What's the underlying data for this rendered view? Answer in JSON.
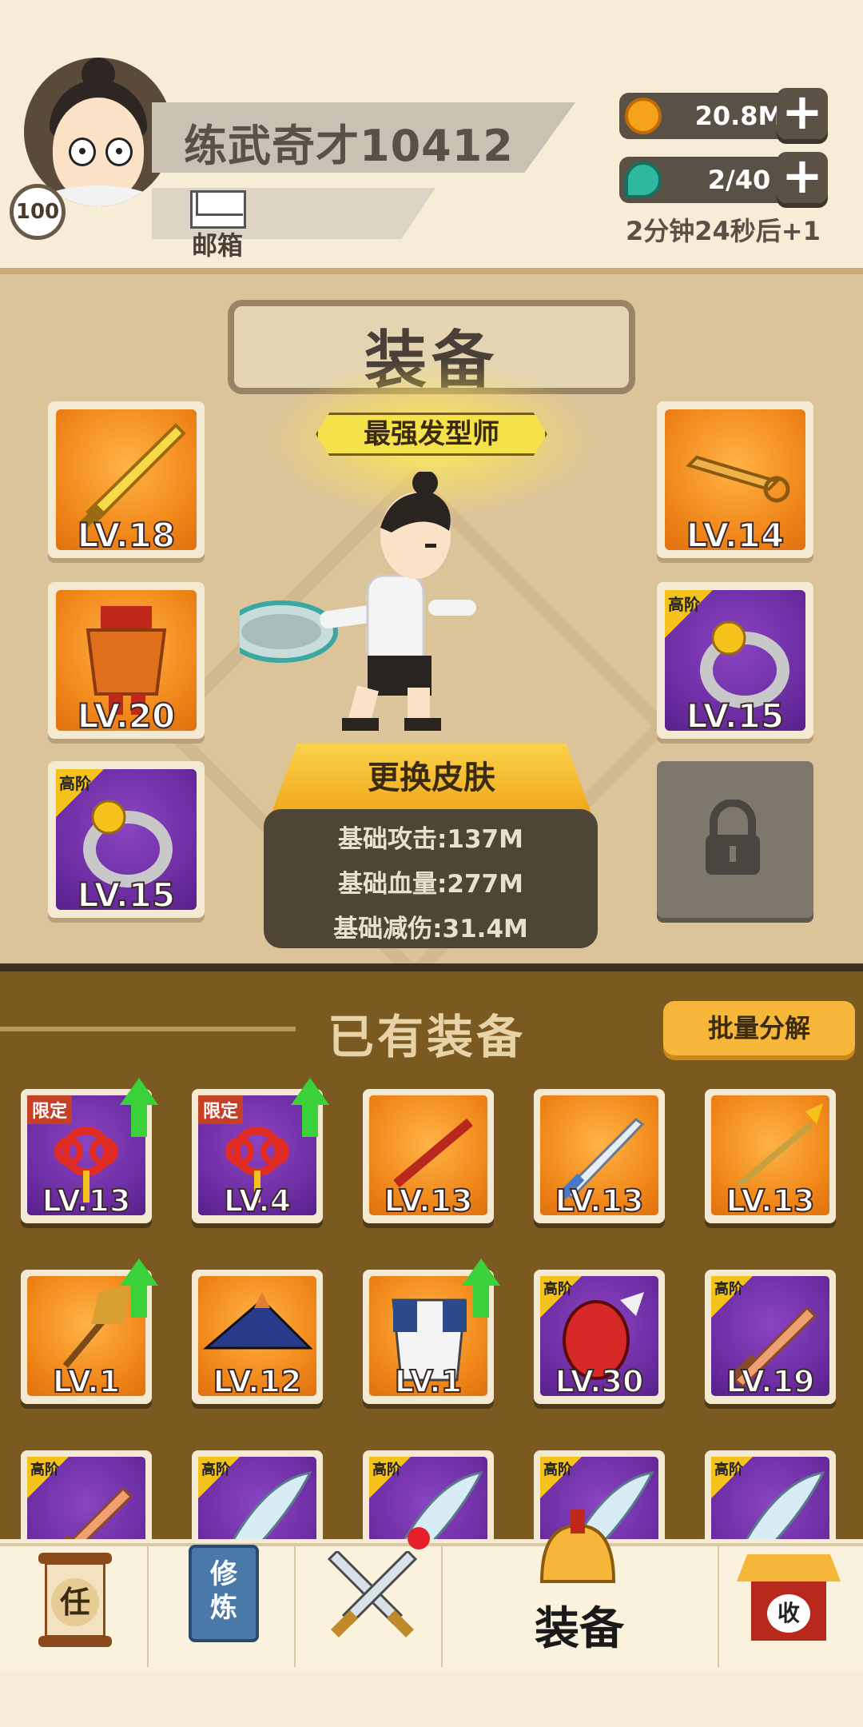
{
  "header": {
    "player_name": "练武奇才10412",
    "level": "100",
    "mail_label": "邮箱",
    "coins": "20.8M",
    "energy": "2/40",
    "timer_text": "2分钟24秒后+1",
    "plus_symbol": "+"
  },
  "equip": {
    "title": "装备",
    "badge_title": "最强发型师",
    "change_skin": "更换皮肤",
    "stats": [
      "基础攻击:137M",
      "基础血量:277M",
      "基础减伤:31.4M"
    ],
    "left_slots": [
      {
        "lv": "LV.18",
        "tier": "",
        "rarity": "orange",
        "icon": "sword-icon"
      },
      {
        "lv": "LV.20",
        "tier": "",
        "rarity": "orange",
        "icon": "armor-icon"
      },
      {
        "lv": "LV.15",
        "tier": "高阶",
        "rarity": "purple",
        "icon": "ring-icon"
      }
    ],
    "right_slots": [
      {
        "lv": "LV.14",
        "tier": "",
        "rarity": "orange",
        "icon": "key-icon"
      },
      {
        "lv": "LV.15",
        "tier": "高阶",
        "rarity": "purple",
        "icon": "ring-icon"
      }
    ],
    "locked_slot_icon": "lock-icon"
  },
  "owned": {
    "title": "已有装备",
    "batch_button": "批量分解",
    "items": [
      {
        "lv": "LV.13",
        "tag": "限定",
        "tier": "",
        "rarity": "purple",
        "upgrade": true,
        "icon": "chinese-knot-icon"
      },
      {
        "lv": "LV.4",
        "tag": "限定",
        "tier": "",
        "rarity": "purple",
        "upgrade": true,
        "icon": "chinese-knot-icon"
      },
      {
        "lv": "LV.13",
        "tag": "",
        "tier": "",
        "rarity": "orange",
        "upgrade": false,
        "icon": "staff-icon"
      },
      {
        "lv": "LV.13",
        "tag": "",
        "tier": "",
        "rarity": "orange",
        "upgrade": false,
        "icon": "sword-icon"
      },
      {
        "lv": "LV.13",
        "tag": "",
        "tier": "",
        "rarity": "orange",
        "upgrade": false,
        "icon": "spear-icon"
      },
      {
        "lv": "LV.1",
        "tag": "",
        "tier": "",
        "rarity": "orange",
        "upgrade": true,
        "icon": "broom-icon"
      },
      {
        "lv": "LV.12",
        "tag": "",
        "tier": "",
        "rarity": "orange",
        "upgrade": false,
        "icon": "hat-icon"
      },
      {
        "lv": "LV.1",
        "tag": "",
        "tier": "",
        "rarity": "orange",
        "upgrade": true,
        "icon": "robe-icon"
      },
      {
        "lv": "LV.30",
        "tag": "",
        "tier": "高阶",
        "rarity": "purple",
        "upgrade": false,
        "icon": "glove-icon"
      },
      {
        "lv": "LV.19",
        "tag": "",
        "tier": "高阶",
        "rarity": "purple",
        "upgrade": false,
        "icon": "wooden-sword-icon"
      },
      {
        "lv": "",
        "tag": "",
        "tier": "高阶",
        "rarity": "purple",
        "upgrade": false,
        "icon": "wooden-sword-icon"
      },
      {
        "lv": "",
        "tag": "",
        "tier": "高阶",
        "rarity": "purple",
        "upgrade": false,
        "icon": "saber-icon"
      },
      {
        "lv": "",
        "tag": "",
        "tier": "高阶",
        "rarity": "purple",
        "upgrade": false,
        "icon": "saber-icon"
      },
      {
        "lv": "",
        "tag": "",
        "tier": "高阶",
        "rarity": "purple",
        "upgrade": false,
        "icon": "saber-icon"
      },
      {
        "lv": "",
        "tag": "",
        "tier": "高阶",
        "rarity": "purple",
        "upgrade": false,
        "icon": "saber-icon"
      }
    ]
  },
  "nav": {
    "task_glyph": "任",
    "cultivate_glyph_1": "修",
    "cultivate_glyph_2": "炼",
    "equip_label": "装备",
    "collect_glyph": "收"
  },
  "colors": {
    "orange_rarity": "#f28a1c",
    "purple_rarity": "#6a2ba0",
    "upgrade_arrow": "#3bd13b",
    "accent_button": "#f5b63a"
  }
}
